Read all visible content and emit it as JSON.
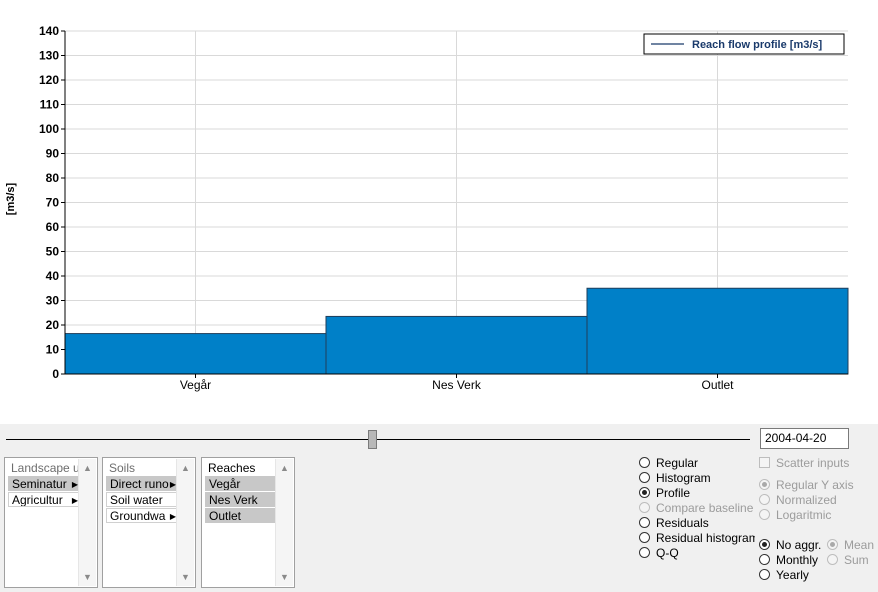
{
  "chart_data": {
    "type": "bar",
    "categories": [
      "Vegår",
      "Nes Verk",
      "Outlet"
    ],
    "series": [
      {
        "name": "Reach flow profile [m3/s]",
        "values": [
          16.5,
          23.5,
          35.0
        ]
      }
    ],
    "ylabel": "[m3/s]",
    "ylim": [
      0,
      140
    ],
    "yticks": [
      0,
      10,
      20,
      30,
      40,
      50,
      60,
      70,
      80,
      90,
      100,
      110,
      120,
      130,
      140
    ],
    "grid": true,
    "legend": "top-right",
    "bar_color": "#0080c8"
  },
  "timeline": {
    "date": "2004-04-20"
  },
  "lists": {
    "landscape": {
      "header": "Landscape u",
      "items": [
        "Seminatur",
        "Agricultur"
      ]
    },
    "soils": {
      "header": "Soils",
      "items": [
        "Direct runo",
        "Soil water",
        "Groundwa"
      ]
    },
    "reaches": {
      "header": "Reaches",
      "items": [
        "Vegår",
        "Nes Verk",
        "Outlet"
      ]
    }
  },
  "plot_types": {
    "regular": "Regular",
    "histogram": "Histogram",
    "profile": "Profile",
    "compare_baseline": "Compare baseline",
    "residuals": "Residuals",
    "residual_histogram": "Residual histogram",
    "qq": "Q-Q"
  },
  "options": {
    "scatter_inputs": "Scatter inputs",
    "regular_y_axis": "Regular Y axis",
    "normalized": "Normalized",
    "logaritmic": "Logaritmic"
  },
  "aggregation": {
    "no_aggr": "No aggr.",
    "monthly": "Monthly",
    "yearly": "Yearly",
    "mean": "Mean",
    "sum": "Sum"
  }
}
